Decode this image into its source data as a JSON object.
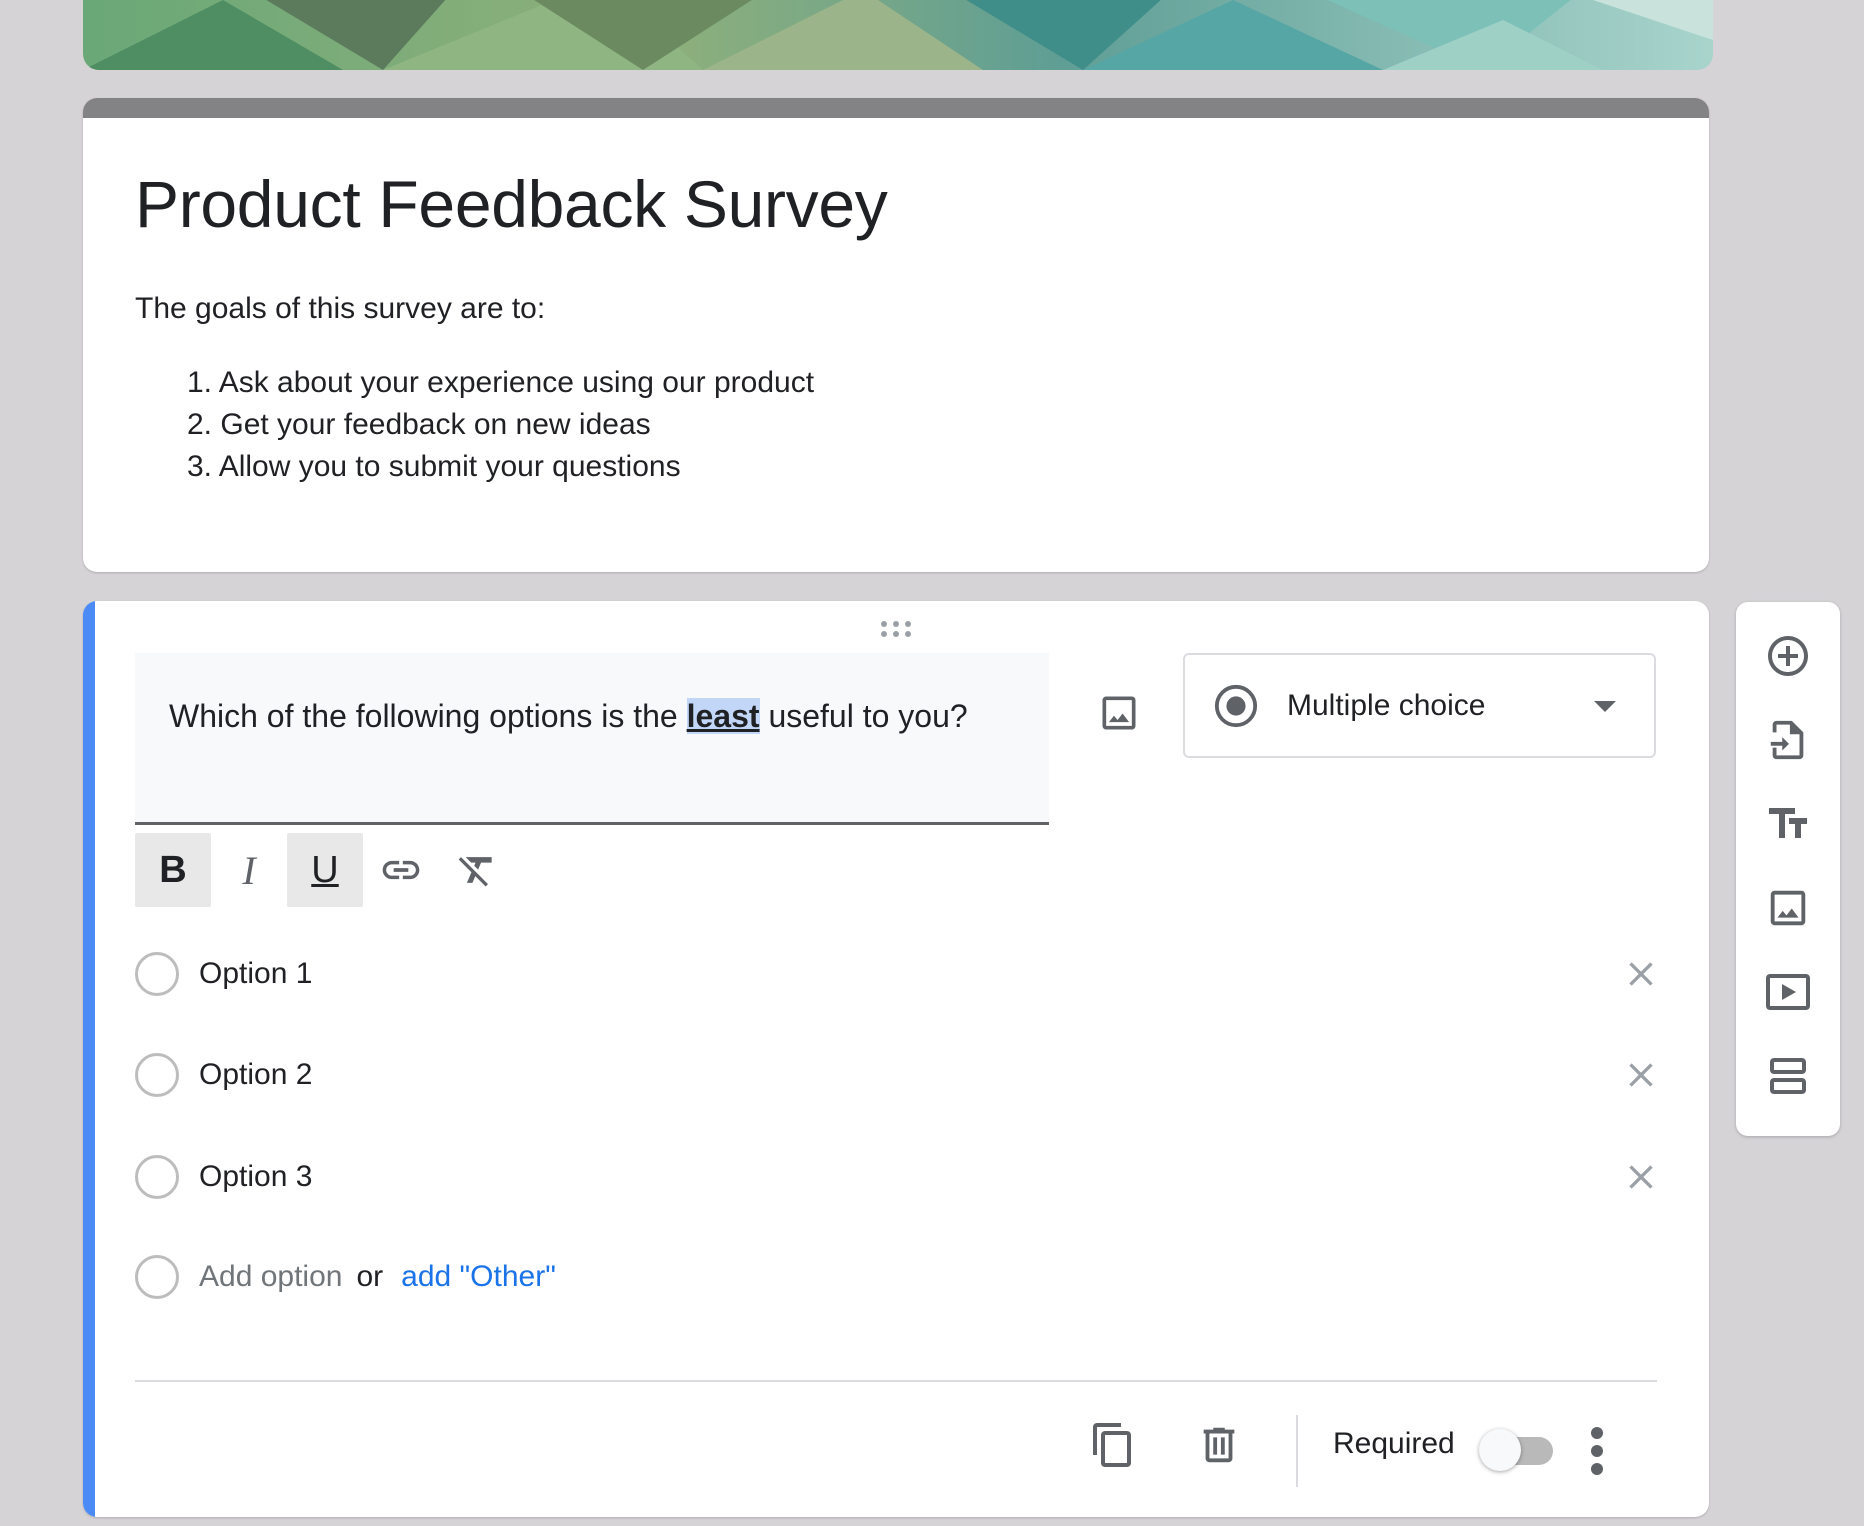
{
  "form": {
    "title": "Product Feedback Survey",
    "description_intro": "The goals of this survey are to:",
    "goals": [
      "1. Ask about your experience using our product",
      "2. Get your feedback on new ideas",
      "3. Allow you to submit your questions"
    ]
  },
  "question": {
    "text_before": "Which of the following options is the ",
    "text_highlight": "least",
    "text_after": " useful to you?",
    "type_label": "Multiple choice",
    "options": [
      {
        "label": "Option 1"
      },
      {
        "label": "Option 2"
      },
      {
        "label": "Option 3"
      }
    ],
    "add_option_label": "Add option",
    "or_label": "or",
    "add_other_label": "add \"Other\"",
    "required_label": "Required",
    "required_on": false
  },
  "formatting": {
    "bold_label": "B",
    "italic_label": "I",
    "underline_label": "U"
  },
  "colors": {
    "accent": "#4c8bf5",
    "link": "#1a73e8",
    "header_bar": "#838385",
    "background": "#d5d3d6"
  },
  "icons": {
    "side_toolbar": [
      "add-question-icon",
      "import-questions-icon",
      "add-title-icon",
      "add-image-icon",
      "add-video-icon",
      "add-section-icon"
    ],
    "footer": [
      "duplicate-icon",
      "delete-icon",
      "more-options-icon"
    ]
  }
}
